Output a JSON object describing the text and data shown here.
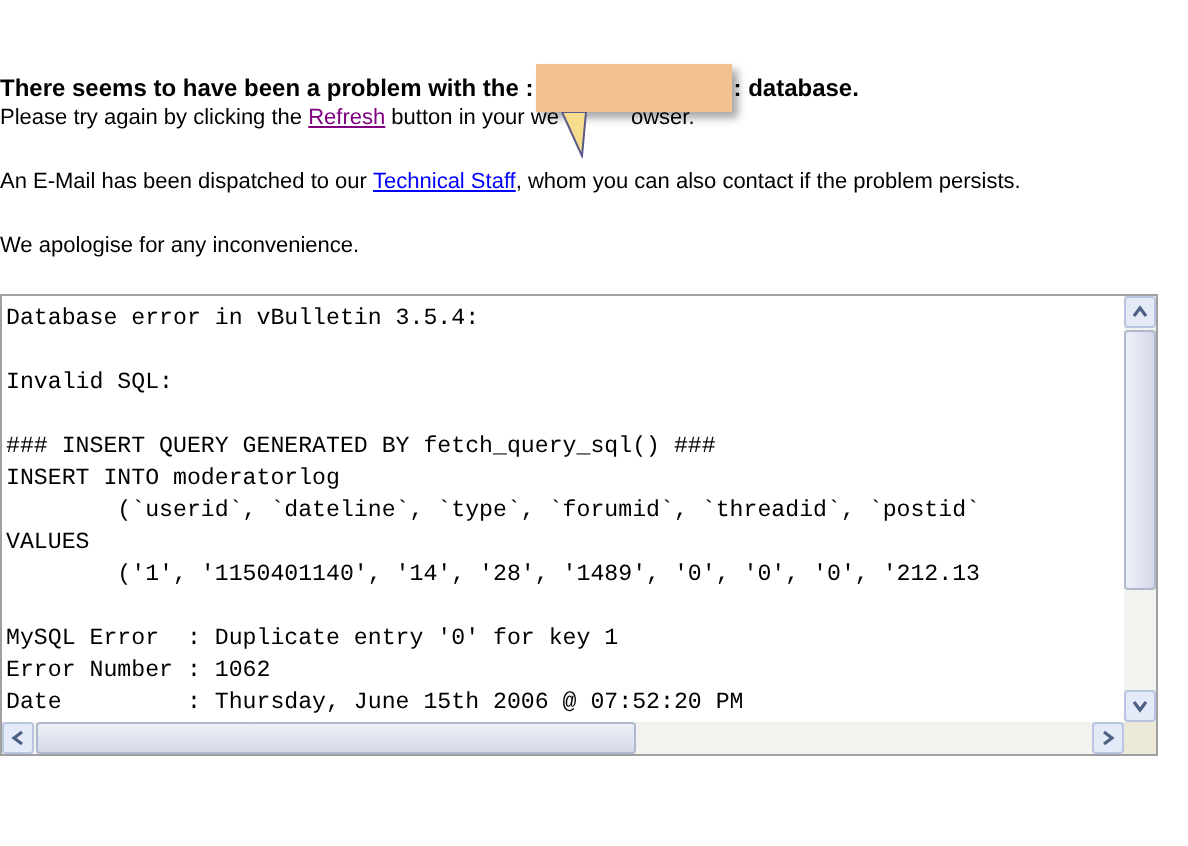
{
  "heading": {
    "before": "There seems to have been a problem with the :",
    "after": ": database."
  },
  "retry": {
    "before": "Please try again by clicking the ",
    "link": "Refresh",
    "after": " button in your we",
    "tail": "owser."
  },
  "email": {
    "before": "An E-Mail has been dispatched to our ",
    "link": "Technical Staff",
    "after": ", whom you can also contact if the problem persists."
  },
  "apology": "We apologise for any inconvenience.",
  "error_blocks": [
    [
      "Database error in vBulletin 3.5.4:"
    ],
    [
      "Invalid SQL:"
    ],
    [
      "### INSERT QUERY GENERATED BY fetch_query_sql() ###",
      "INSERT INTO moderatorlog",
      "        (`userid`, `dateline`, `type`, `forumid`, `threadid`, `postid`",
      "VALUES",
      "        ('1', '1150401140', '14', '28', '1489', '0', '0', '0', '212.13"
    ],
    [
      "MySQL Error  : Duplicate entry '0' for key 1",
      "Error Number : 1062",
      "Date         : Thursday, June 15th 2006 @ 07:52:20 PM"
    ]
  ]
}
